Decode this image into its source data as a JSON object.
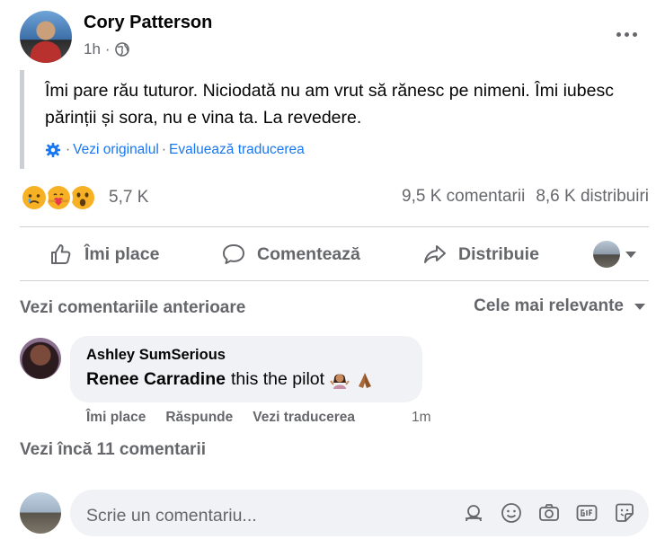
{
  "post": {
    "author": "Cory Patterson",
    "time": "1h",
    "meta_separator": "·",
    "text": "Îmi pare rău tuturor. Niciodată nu am vrut să rănesc pe nimeni. Îmi iubesc părinții și sora, nu e vina ta. La revedere.",
    "see_original": "Vezi originalul",
    "rate_translation": "Evaluează traducerea",
    "separator": "·"
  },
  "reactions": {
    "types": [
      "sad-icon",
      "care-icon",
      "wow-icon"
    ],
    "count": "5,7 K",
    "comments": "9,5 K comentarii",
    "shares": "8,6 K distribuiri"
  },
  "actions": {
    "like": "Îmi place",
    "comment": "Comentează",
    "share": "Distribuie"
  },
  "comments_section": {
    "previous": "Vezi comentariile anterioare",
    "sort": "Cele mai relevante",
    "more": "Vezi încă 11 comentarii"
  },
  "comment": {
    "author": "Ashley SumSerious",
    "tag": "Renee Carradine",
    "text": "this the pilot",
    "emojis": [
      "woman-shrugging-icon",
      "folded-hands-icon"
    ],
    "like": "Îmi place",
    "reply": "Răspunde",
    "see_translation": "Vezi traducerea",
    "time": "1m"
  },
  "composer": {
    "placeholder": "Scrie un comentariu..."
  },
  "colors": {
    "link": "#1877f2",
    "secondary_text": "#65676b",
    "bubble": "#f0f2f5",
    "reaction_yellow": "#f7b125"
  }
}
